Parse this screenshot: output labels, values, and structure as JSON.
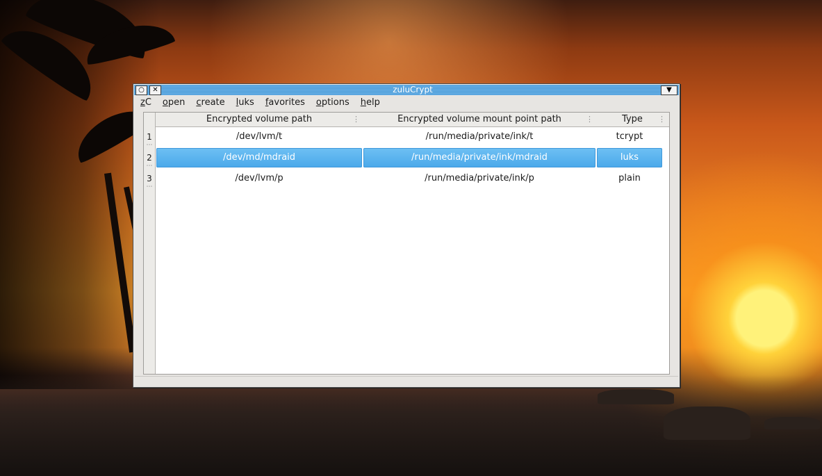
{
  "window": {
    "title": "zuluCrypt",
    "titlebar_buttons": [
      "circle-icon",
      "close-icon",
      "dropdown-arrow-icon"
    ]
  },
  "menu": {
    "items": [
      {
        "label_ul": "z",
        "label_rest": "C"
      },
      {
        "label_ul": "o",
        "label_rest": "pen"
      },
      {
        "label_ul": "c",
        "label_rest": "reate"
      },
      {
        "label_ul": "l",
        "label_rest": "uks"
      },
      {
        "label_ul": "f",
        "label_rest": "avorites"
      },
      {
        "label_ul": "o",
        "label_rest": "ptions"
      },
      {
        "label_ul": "h",
        "label_rest": "elp"
      }
    ]
  },
  "table": {
    "headers": [
      "Encrypted volume path",
      "Encrypted volume mount point path",
      "Type"
    ],
    "rows": [
      {
        "num": "1",
        "path": "/dev/lvm/t",
        "mount": "/run/media/private/ink/t",
        "type": "tcrypt",
        "selected": false
      },
      {
        "num": "2",
        "path": "/dev/md/mdraid",
        "mount": "/run/media/private/ink/mdraid",
        "type": "luks",
        "selected": true
      },
      {
        "num": "3",
        "path": "/dev/lvm/p",
        "mount": "/run/media/private/ink/p",
        "type": "plain",
        "selected": false
      }
    ]
  },
  "colors": {
    "selection": "#4aa8ea",
    "titlebar": "#4a9ad6"
  }
}
